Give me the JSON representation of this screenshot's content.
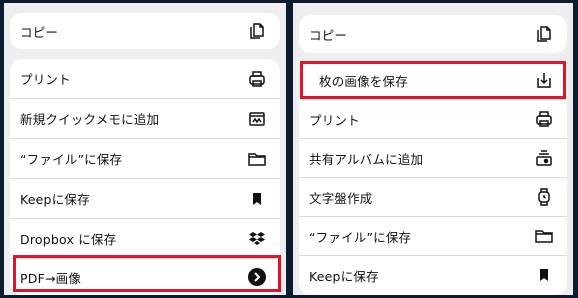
{
  "left_panel": {
    "items": [
      {
        "label": "コピー",
        "icon": "copy-icon"
      },
      {
        "label": "プリント",
        "icon": "print-icon"
      },
      {
        "label": "新規クイックメモに追加",
        "icon": "quick-note-icon"
      },
      {
        "label": "“ファイル”に保存",
        "icon": "folder-icon"
      },
      {
        "label": "Keepに保存",
        "icon": "bookmark-icon"
      },
      {
        "label": "Dropbox に保存",
        "icon": "dropbox-icon"
      },
      {
        "label": "PDF→画像",
        "icon": "chevron-right-circle-icon"
      }
    ],
    "highlighted_item": "PDF→画像"
  },
  "right_panel": {
    "items": [
      {
        "label": "コピー",
        "icon": "copy-icon"
      },
      {
        "label": "枚の画像を保存",
        "icon": "save-image-icon"
      },
      {
        "label": "プリント",
        "icon": "print-icon"
      },
      {
        "label": "共有アルバムに追加",
        "icon": "shared-album-icon"
      },
      {
        "label": "文字盤作成",
        "icon": "watch-face-icon"
      },
      {
        "label": "“ファイル”に保存",
        "icon": "folder-icon"
      },
      {
        "label": "Keepに保存",
        "icon": "bookmark-icon"
      }
    ],
    "highlighted_item": "枚の画像を保存"
  },
  "colors": {
    "background": "#0d1b2e",
    "panel": "#eeeef0",
    "card": "#ffffff",
    "highlight": "#e0142b"
  }
}
